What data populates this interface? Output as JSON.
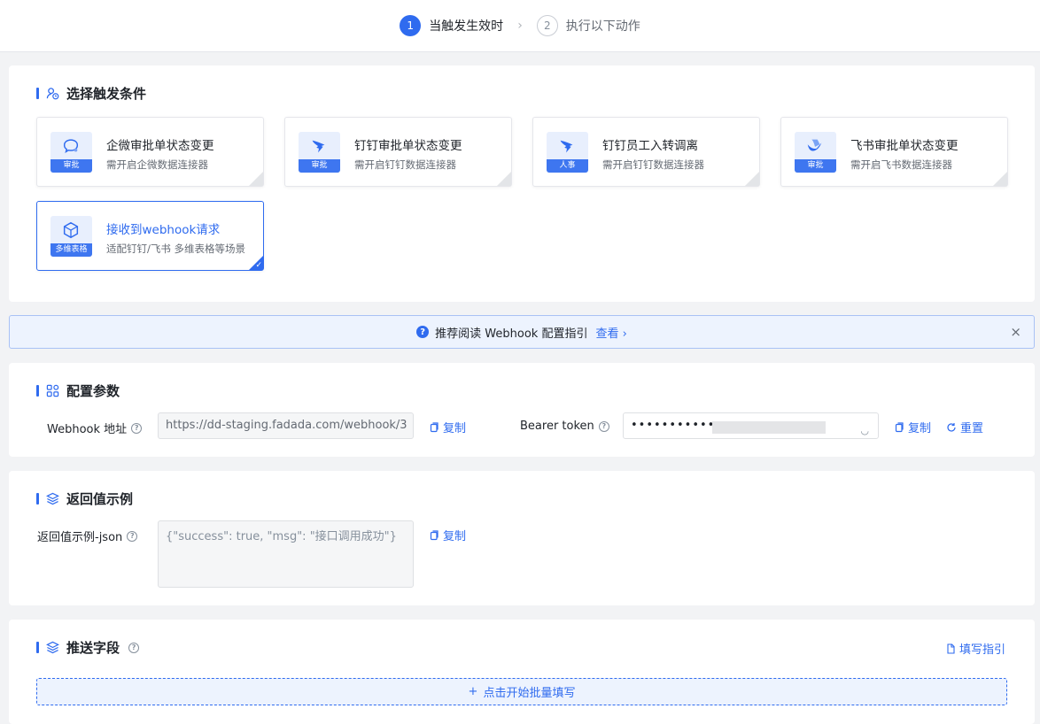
{
  "steps": [
    {
      "num": "1",
      "label": "当触发生效时"
    },
    {
      "num": "2",
      "label": "执行以下动作"
    }
  ],
  "trigger_section": {
    "title": "选择触发条件",
    "cards": [
      {
        "title": "企微审批单状态变更",
        "desc": "需开启企微数据连接器",
        "tag": "审批",
        "icon": "chat-bubble-icon"
      },
      {
        "title": "钉钉审批单状态变更",
        "desc": "需开启钉钉数据连接器",
        "tag": "审批",
        "icon": "dingtalk-icon"
      },
      {
        "title": "钉钉员工入转调离",
        "desc": "需开启钉钉数据连接器",
        "tag": "人事",
        "icon": "dingtalk-icon"
      },
      {
        "title": "飞书审批单状态变更",
        "desc": "需开启飞书数据连接器",
        "tag": "审批",
        "icon": "feishu-icon"
      },
      {
        "title": "接收到webhook请求",
        "desc": "适配钉钉/飞书 多维表格等场景",
        "tag": "多维表格",
        "icon": "cube-icon"
      }
    ]
  },
  "notice": {
    "text": "推荐阅读 Webhook 配置指引",
    "link": "查看 ›",
    "close": "×"
  },
  "config_section": {
    "title": "配置参数",
    "webhook_label": "Webhook 地址",
    "webhook_value": "https://dd-staging.fadada.com/webhook/3",
    "copy": "复制",
    "token_label": "Bearer token",
    "token_value": "••••••••••••••",
    "reset": "重置"
  },
  "return_section": {
    "title": "返回值示例",
    "label": "返回值示例-json",
    "value": "{\"success\": true, \"msg\": \"接口调用成功\"}",
    "copy": "复制"
  },
  "push_section": {
    "title": "推送字段",
    "guide": "填写指引",
    "batch_button": "点击开始批量填写"
  },
  "colors": {
    "accent": "#2f6bef",
    "accent_light": "#edf3fe",
    "background": "#f2f3f5"
  }
}
